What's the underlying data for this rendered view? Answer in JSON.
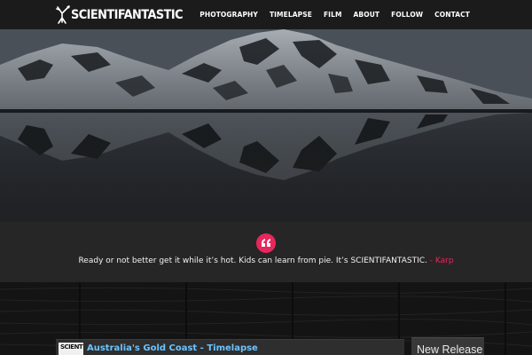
{
  "header": {
    "logo_text": "SCIENTIFANTASTIC",
    "nav": [
      "PHOTOGRAPHY",
      "TIMELAPSE",
      "FILM",
      "ABOUT",
      "FOLLOW",
      "CONTACT"
    ]
  },
  "quote": {
    "icon": "quote-icon",
    "text": "Ready or not better get it while it’s hot. Kids can learn from pie. It’s SCIENTIFANTASTIC.",
    "author": "- Karp"
  },
  "video": {
    "thumb_text": "SCIENTI",
    "title": "Australia's Gold Coast - Timelapse"
  },
  "release": {
    "title": "New Release"
  },
  "colors": {
    "accent": "#e8275c",
    "link": "#6cc3ff",
    "topbar": "#1b1b1b",
    "quote_band": "#262626"
  }
}
